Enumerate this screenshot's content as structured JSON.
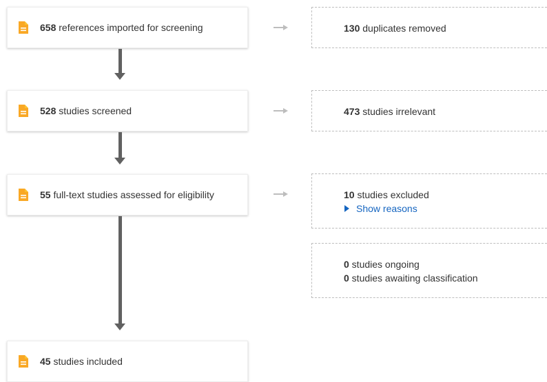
{
  "flow": {
    "left": [
      {
        "count": "658",
        "text": " references imported for screening"
      },
      {
        "count": "528",
        "text": " studies screened"
      },
      {
        "count": "55",
        "text": " full-text studies assessed for eligibility"
      },
      {
        "count": "45",
        "text": " studies included"
      }
    ],
    "right": {
      "duplicates": {
        "count": "130",
        "text": " duplicates removed"
      },
      "irrelevant": {
        "count": "473",
        "text": " studies irrelevant"
      },
      "excluded": {
        "count": "10",
        "text": " studies excluded",
        "show_reasons": "Show reasons"
      },
      "other": {
        "ongoing_count": "0",
        "ongoing_text": " studies ongoing",
        "awaiting_count": "0",
        "awaiting_text": " studies awaiting classification"
      }
    }
  },
  "colors": {
    "doc_icon": "#f9a825",
    "arrow": "#616161",
    "link": "#1565c0"
  },
  "icons": {
    "document": "document-icon",
    "arrow_right": "arrow-right-icon",
    "arrow_down": "arrow-down-icon"
  }
}
